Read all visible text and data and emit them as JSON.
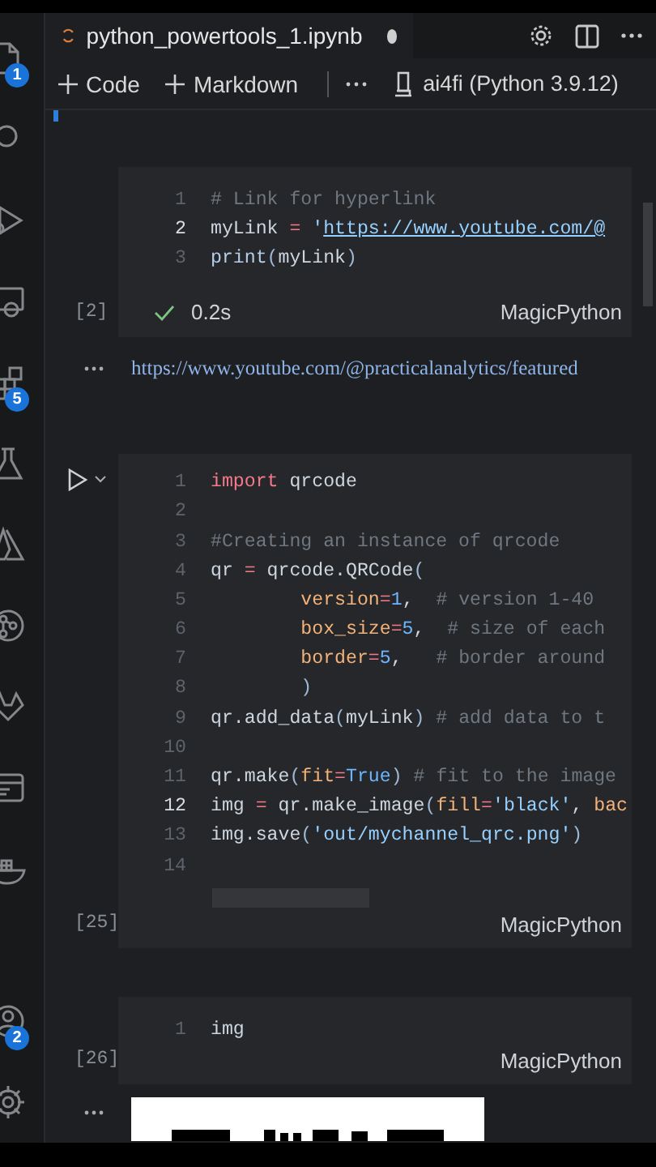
{
  "activity_bar": {
    "items": [
      {
        "kind": "files",
        "badge": "1"
      },
      {
        "kind": "search"
      },
      {
        "kind": "debug"
      },
      {
        "kind": "remote"
      },
      {
        "kind": "extensions",
        "badge": "5"
      },
      {
        "kind": "testing"
      },
      {
        "kind": "azure"
      },
      {
        "kind": "git"
      },
      {
        "kind": "gitlab"
      },
      {
        "kind": "panel"
      },
      {
        "kind": "docker"
      },
      {
        "kind": "account",
        "badge": "2"
      },
      {
        "kind": "settings"
      }
    ]
  },
  "tab": {
    "title": "python_powertools_1.ipynb",
    "dirty": true
  },
  "toolbar": {
    "buttons": [
      "Code",
      "Markdown"
    ],
    "kernel": "ai4fi (Python 3.9.12)"
  },
  "cells": [
    {
      "run_visible": false,
      "execution_count": "[2]",
      "succeeded": true,
      "duration": "0.2s",
      "language": "MagicPython",
      "lines": [
        {
          "number": "1",
          "current": false,
          "tokens": [
            {
              "kind": "cm",
              "text": "# Link for hyperlink"
            }
          ]
        },
        {
          "number": "2",
          "current": true,
          "tokens": [
            {
              "kind": "id",
              "text": "myLink "
            },
            {
              "kind": "op",
              "text": "="
            },
            {
              "kind": "str",
              "text": " '"
            },
            {
              "kind": "link",
              "text": "https://www.youtube.com/@"
            }
          ]
        },
        {
          "number": "3",
          "current": false,
          "tokens": [
            {
              "kind": "fn",
              "text": "print"
            },
            {
              "kind": "punc",
              "text": "("
            },
            {
              "kind": "id",
              "text": "myLink"
            },
            {
              "kind": "punc",
              "text": ")"
            }
          ]
        }
      ],
      "output": {
        "kind": "link",
        "text": "https://www.youtube.com/@practicalanalytics/featured"
      }
    },
    {
      "run_visible": true,
      "execution_count": "[25]",
      "language": "MagicPython",
      "lines": [
        {
          "number": "1",
          "current": false,
          "tokens": [
            {
              "kind": "kw",
              "text": "import"
            },
            {
              "kind": "id",
              "text": " qrcode"
            }
          ]
        },
        {
          "number": "2",
          "current": false
        },
        {
          "number": "3",
          "current": false,
          "tokens": [
            {
              "kind": "cm",
              "text": "#Creating an instance of qrcode"
            }
          ]
        },
        {
          "number": "4",
          "current": false,
          "tokens": [
            {
              "kind": "id",
              "text": "qr "
            },
            {
              "kind": "op",
              "text": "="
            },
            {
              "kind": "id",
              "text": " qrcode.QRCode"
            },
            {
              "kind": "punc",
              "text": "("
            }
          ]
        },
        {
          "number": "5",
          "current": false,
          "tokens": [
            {
              "kind": "param",
              "text": "        version"
            },
            {
              "kind": "op",
              "text": "="
            },
            {
              "kind": "num",
              "text": "1"
            },
            {
              "kind": "id",
              "text": ",  "
            },
            {
              "kind": "cm",
              "text": "# version 1-40"
            }
          ]
        },
        {
          "number": "6",
          "current": false,
          "tokens": [
            {
              "kind": "param",
              "text": "        box_size"
            },
            {
              "kind": "op",
              "text": "="
            },
            {
              "kind": "num",
              "text": "5"
            },
            {
              "kind": "id",
              "text": ",  "
            },
            {
              "kind": "cm",
              "text": "# size of each"
            }
          ]
        },
        {
          "number": "7",
          "current": false,
          "tokens": [
            {
              "kind": "param",
              "text": "        border"
            },
            {
              "kind": "op",
              "text": "="
            },
            {
              "kind": "num",
              "text": "5"
            },
            {
              "kind": "id",
              "text": ",   "
            },
            {
              "kind": "cm",
              "text": "# border around"
            }
          ]
        },
        {
          "number": "8",
          "current": false,
          "tokens": [
            {
              "kind": "punc",
              "text": "        )"
            }
          ]
        },
        {
          "number": "9",
          "current": false,
          "tokens": [
            {
              "kind": "id",
              "text": "qr.add_data"
            },
            {
              "kind": "punc",
              "text": "("
            },
            {
              "kind": "id",
              "text": "myLink"
            },
            {
              "kind": "punc",
              "text": ")"
            },
            {
              "kind": "cm",
              "text": " # add data to t"
            }
          ]
        },
        {
          "number": "10",
          "current": false
        },
        {
          "number": "11",
          "current": false,
          "tokens": [
            {
              "kind": "id",
              "text": "qr.make"
            },
            {
              "kind": "punc",
              "text": "("
            },
            {
              "kind": "param",
              "text": "fit"
            },
            {
              "kind": "op",
              "text": "="
            },
            {
              "kind": "num",
              "text": "True"
            },
            {
              "kind": "punc",
              "text": ")"
            },
            {
              "kind": "cm",
              "text": " # fit to the image"
            }
          ]
        },
        {
          "number": "12",
          "current": true,
          "tokens": [
            {
              "kind": "id",
              "text": "img "
            },
            {
              "kind": "op",
              "text": "="
            },
            {
              "kind": "id",
              "text": " qr.make_image"
            },
            {
              "kind": "punc",
              "text": "("
            },
            {
              "kind": "param",
              "text": "fill"
            },
            {
              "kind": "op",
              "text": "="
            },
            {
              "kind": "str",
              "text": "'black'"
            },
            {
              "kind": "id",
              "text": ", "
            },
            {
              "kind": "param",
              "text": "bac"
            }
          ]
        },
        {
          "number": "13",
          "current": false,
          "tokens": [
            {
              "kind": "id",
              "text": "img.save"
            },
            {
              "kind": "punc",
              "text": "("
            },
            {
              "kind": "str",
              "text": "'out/mychannel_qrc.png'"
            },
            {
              "kind": "punc",
              "text": ")"
            }
          ]
        },
        {
          "number": "14",
          "current": false
        }
      ]
    },
    {
      "run_visible": false,
      "execution_count": "[26]",
      "language": "MagicPython",
      "lines": [
        {
          "number": "1",
          "current": false,
          "tokens": [
            {
              "kind": "id",
              "text": "img"
            }
          ]
        }
      ],
      "output": {
        "kind": "image"
      }
    }
  ]
}
